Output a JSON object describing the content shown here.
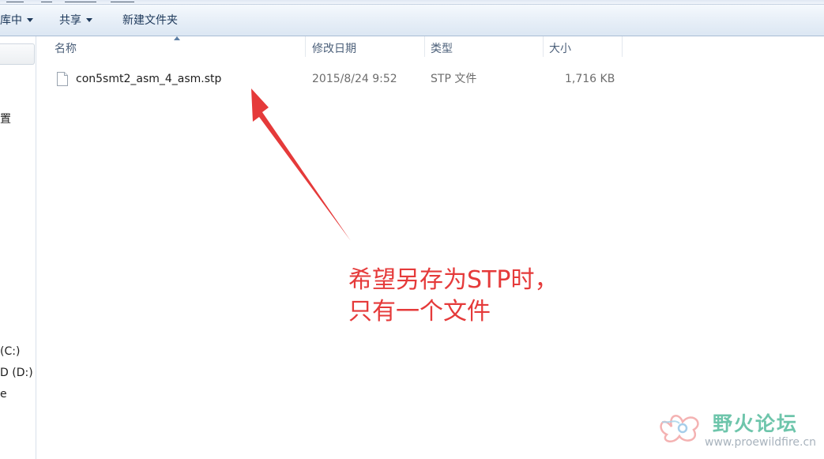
{
  "toolbar": {
    "library_label": "库中",
    "share_label": "共享",
    "new_folder_label": "新建文件夹"
  },
  "nav": {
    "frag_settings": "置",
    "frag_drive_c": "(C:)",
    "frag_drive_d": "D (D:)",
    "frag_e": "e"
  },
  "columns": {
    "name": "名称",
    "modified": "修改日期",
    "type": "类型",
    "size": "大小"
  },
  "files": [
    {
      "name": "con5smt2_asm_4_asm.stp",
      "modified": "2015/8/24 9:52",
      "type": "STP 文件",
      "size": "1,716 KB"
    }
  ],
  "annotation": {
    "line1": "希望另存为STP时，",
    "line2": "只有一个文件",
    "color": "#e53a3a"
  },
  "watermark": {
    "title": "野火论坛",
    "url": "www.proewildfire.cn"
  },
  "colors": {
    "toolbar_text": "#1e395b",
    "header_text": "#4c607a",
    "annotation": "#e53a3a"
  }
}
